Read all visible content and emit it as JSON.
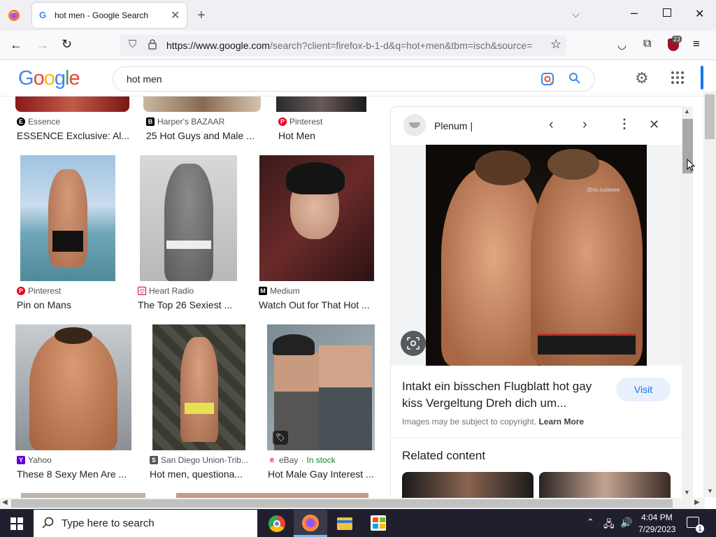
{
  "browser": {
    "tab_title": "hot men - Google Search",
    "url_host": "https://www.google.com",
    "url_path": "/search?client=firefox-b-1-d&q=hot+men&tbm=isch&source=",
    "extension_badge": "23"
  },
  "google": {
    "logo_letters": [
      "G",
      "o",
      "o",
      "g",
      "l",
      "e"
    ],
    "logo_colors": [
      "#4285f4",
      "#ea4335",
      "#fbbc05",
      "#4285f4",
      "#34a853",
      "#ea4335"
    ],
    "query": "hot men"
  },
  "results": {
    "row0": [
      {
        "source": "Essence",
        "title": "ESSENCE Exclusive: Al...",
        "fav": "E",
        "favcolor": "#000000"
      },
      {
        "source": "Harper's BAZAAR",
        "title": "25 Hot Guys and Male ...",
        "fav": "B",
        "favcolor": "#000000"
      },
      {
        "source": "Pinterest",
        "title": "Hot Men",
        "fav": "P",
        "favcolor": "#e60023"
      }
    ],
    "row1": [
      {
        "source": "Pinterest",
        "title": "Pin on Mans",
        "fav": "P",
        "favcolor": "#e60023"
      },
      {
        "source": "Heart Radio",
        "title": "The Top 26 Sexiest ...",
        "fav": "♡",
        "favcolor": "#c6002b"
      },
      {
        "source": "Medium",
        "title": "Watch Out for That Hot ...",
        "fav": "M",
        "favcolor": "#000000"
      }
    ],
    "row2": [
      {
        "source": "Yahoo",
        "title": "These 8 Sexy Men Are ...",
        "fav": "Y",
        "favcolor": "#6001d2"
      },
      {
        "source": "San Diego Union-Trib...",
        "title": "Hot men, questiona...",
        "fav": "S",
        "favcolor": "#555555"
      },
      {
        "source": "eBay",
        "stock": "In stock",
        "title": "Hot Male Gay Interest ...",
        "fav": "e",
        "favcolor": "#e53238"
      }
    ]
  },
  "panel": {
    "site": "Plenum |",
    "title_line1": "Intakt ein bisschen Flugblatt hot gay",
    "title_line2": "kiss Vergeltung Dreh dich um...",
    "visit_label": "Visit",
    "copyright": "Images may be subject to copyright.",
    "learn_more": "Learn More",
    "related": "Related content",
    "watermark": "@xo.cuteeee"
  },
  "taskbar": {
    "search_placeholder": "Type here to search",
    "time": "4:04 PM",
    "date": "7/29/2023",
    "notification_count": "1"
  }
}
